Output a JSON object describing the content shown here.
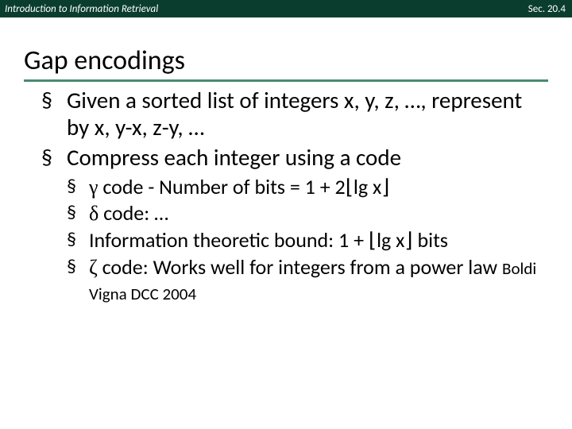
{
  "header": {
    "left": "Introduction to Information Retrieval",
    "right": "Sec. 20.4"
  },
  "title": "Gap encodings",
  "bullets": {
    "b1": "Given a sorted list of integers x, y, z, …, represent by x, y-x, z-y, …",
    "b2": "Compress each integer using a code",
    "sub": {
      "s1_pre": "γ",
      "s1_mid": " code - Number of bits = 1 + 2",
      "s1_floorL": "⌊",
      "s1_lg": "lg x",
      "s1_floorR": "⌋",
      "s2_pre": "δ",
      "s2_rest": " code: …",
      "s3_pre": "Information theoretic bound: 1 + ",
      "s3_floorL": "⌊",
      "s3_lg": "lg x",
      "s3_floorR": "⌋",
      "s3_tail": " bits",
      "s4_pre": "ζ",
      "s4_mid": " code: Works well for integers from a power law ",
      "s4_ref": "Boldi Vigna DCC 2004"
    }
  }
}
